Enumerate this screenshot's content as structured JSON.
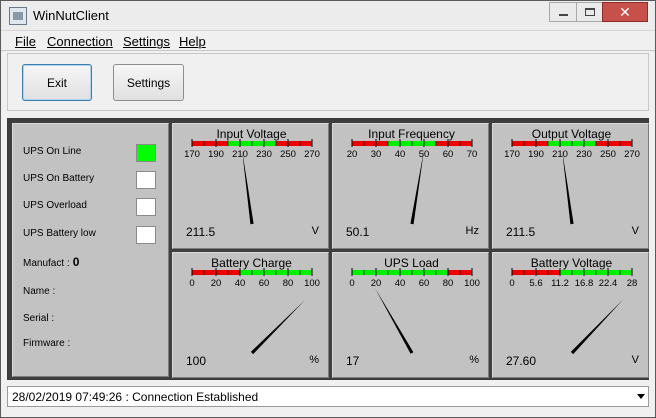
{
  "window": {
    "title": "WinNutClient",
    "close_glyph": "✕"
  },
  "menu": [
    {
      "label": "File"
    },
    {
      "label": "Connection"
    },
    {
      "label": "Settings"
    },
    {
      "label": "Help"
    }
  ],
  "toolbar": {
    "exit_label": "Exit",
    "settings_label": "Settings"
  },
  "status": {
    "indicators": [
      {
        "label": "UPS On Line",
        "on": true
      },
      {
        "label": "UPS On Battery",
        "on": false
      },
      {
        "label": "UPS Overload",
        "on": false
      },
      {
        "label": "UPS Battery low",
        "on": false
      }
    ],
    "info": [
      {
        "label": "Manufact :",
        "value": "0"
      },
      {
        "label": "Name :",
        "value": ""
      },
      {
        "label": "Serial :",
        "value": ""
      },
      {
        "label": "Firmware :",
        "value": ""
      }
    ],
    "led_on_color": "#00ff00",
    "led_off_color": "#ffffff"
  },
  "gauges": [
    {
      "title": "Input Voltage",
      "ticks": [
        "170",
        "190",
        "210",
        "230",
        "250",
        "270"
      ],
      "min": 170,
      "max": 270,
      "value": 211.5,
      "value_text": "211.5",
      "unit": "V",
      "bands": [
        {
          "from": 170,
          "to": 200,
          "color": "#ee0000"
        },
        {
          "from": 200,
          "to": 240,
          "color": "#00ee00"
        },
        {
          "from": 240,
          "to": 270,
          "color": "#ee0000"
        }
      ]
    },
    {
      "title": "Input Frequency",
      "ticks": [
        "20",
        "30",
        "40",
        "50",
        "60",
        "70"
      ],
      "min": 20,
      "max": 70,
      "value": 50.1,
      "value_text": "50.1",
      "unit": "Hz",
      "bands": [
        {
          "from": 20,
          "to": 35,
          "color": "#ee0000"
        },
        {
          "from": 35,
          "to": 55,
          "color": "#00ee00"
        },
        {
          "from": 55,
          "to": 70,
          "color": "#ee0000"
        }
      ]
    },
    {
      "title": "Output Voltage",
      "ticks": [
        "170",
        "190",
        "210",
        "230",
        "250",
        "270"
      ],
      "min": 170,
      "max": 270,
      "value": 211.5,
      "value_text": "211.5",
      "unit": "V",
      "bands": [
        {
          "from": 170,
          "to": 200,
          "color": "#ee0000"
        },
        {
          "from": 200,
          "to": 240,
          "color": "#00ee00"
        },
        {
          "from": 240,
          "to": 270,
          "color": "#ee0000"
        }
      ]
    },
    {
      "title": "Battery Charge",
      "ticks": [
        "0",
        "20",
        "40",
        "60",
        "80",
        "100"
      ],
      "min": 0,
      "max": 100,
      "value": 100,
      "value_text": "100",
      "unit": "%",
      "bands": [
        {
          "from": 0,
          "to": 40,
          "color": "#ee0000"
        },
        {
          "from": 40,
          "to": 100,
          "color": "#00ee00"
        }
      ]
    },
    {
      "title": "UPS Load",
      "ticks": [
        "0",
        "20",
        "40",
        "60",
        "80",
        "100"
      ],
      "min": 0,
      "max": 100,
      "value": 17,
      "value_text": "17",
      "unit": "%",
      "bands": [
        {
          "from": 0,
          "to": 80,
          "color": "#00ee00"
        },
        {
          "from": 80,
          "to": 100,
          "color": "#ee0000"
        }
      ]
    },
    {
      "title": "Battery Voltage",
      "ticks": [
        "0",
        "5.6",
        "11.2",
        "16.8",
        "22.4",
        "28"
      ],
      "min": 0,
      "max": 28,
      "value": 27.6,
      "value_text": "27.60",
      "unit": "V",
      "bands": [
        {
          "from": 0,
          "to": 11.2,
          "color": "#ee0000"
        },
        {
          "from": 11.2,
          "to": 28,
          "color": "#00ee00"
        }
      ]
    }
  ],
  "statusbar": {
    "text": "28/02/2019 07:49:26 : Connection Established"
  }
}
